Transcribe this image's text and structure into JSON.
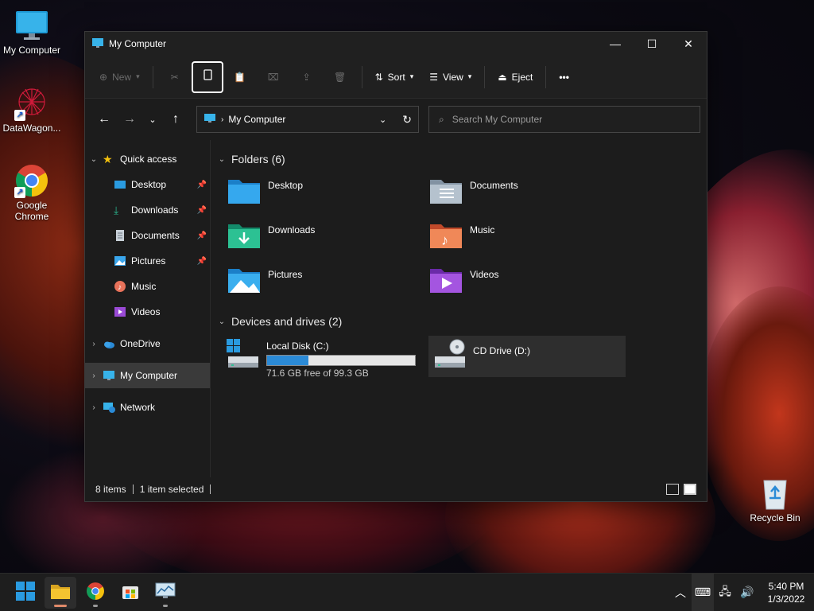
{
  "desktop": {
    "icons": [
      {
        "label": "My Computer"
      },
      {
        "label": "DataWagon..."
      },
      {
        "label": "Google Chrome"
      },
      {
        "label": "Recycle Bin"
      }
    ]
  },
  "window": {
    "title": "My Computer",
    "toolbar": {
      "new_label": "New",
      "sort_label": "Sort",
      "view_label": "View",
      "eject_label": "Eject",
      "more_label": "•••"
    },
    "address": {
      "path": "My Computer"
    },
    "search": {
      "placeholder": "Search My Computer"
    },
    "sidebar": {
      "quick_access": "Quick access",
      "items": [
        {
          "label": "Desktop",
          "pinned": true
        },
        {
          "label": "Downloads",
          "pinned": true
        },
        {
          "label": "Documents",
          "pinned": true
        },
        {
          "label": "Pictures",
          "pinned": true
        },
        {
          "label": "Music",
          "pinned": false
        },
        {
          "label": "Videos",
          "pinned": false
        }
      ],
      "onedrive": "OneDrive",
      "my_computer": "My Computer",
      "network": "Network"
    },
    "folders_header": "Folders (6)",
    "folders": [
      {
        "name": "Desktop"
      },
      {
        "name": "Documents"
      },
      {
        "name": "Downloads"
      },
      {
        "name": "Music"
      },
      {
        "name": "Pictures"
      },
      {
        "name": "Videos"
      }
    ],
    "drives_header": "Devices and drives (2)",
    "drives": [
      {
        "name": "Local Disk (C:)",
        "free_text": "71.6 GB free of 99.3 GB",
        "used_fraction": 0.28
      },
      {
        "name": "CD Drive (D:)"
      }
    ],
    "status": {
      "items": "8 items",
      "selected": "1 item selected"
    }
  },
  "taskbar": {
    "time": "5:40 PM",
    "date": "1/3/2022"
  },
  "colors": {
    "accent": "#2b8ad6",
    "window_bg": "#1c1c1c",
    "selected_bg": "#3a3a3a"
  }
}
